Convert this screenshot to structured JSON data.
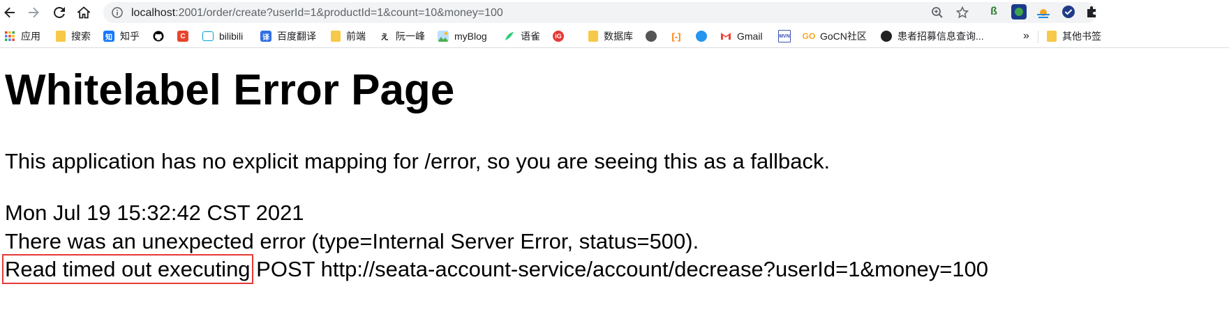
{
  "browser": {
    "url_host": "localhost",
    "url_rest": ":2001/order/create?userId=1&productId=1&count=10&money=100"
  },
  "bookmarks": [
    {
      "label": "应用",
      "icon": "apps-grid-icon",
      "color": "#ea4335"
    },
    {
      "label": "搜索",
      "icon": "folder-icon",
      "color": "#f7c948"
    },
    {
      "label": "知乎",
      "icon": "zhihu-icon",
      "color": "#1677ff"
    },
    {
      "label": "",
      "icon": "github-icon",
      "color": "#000000"
    },
    {
      "label": "",
      "icon": "c-icon",
      "color": "#e8452c"
    },
    {
      "label": "bilibili",
      "icon": "bilibili-icon",
      "color": "#00a1d6"
    },
    {
      "label": "百度翻译",
      "icon": "baidu-translate-icon",
      "color": "#2f6fe4"
    },
    {
      "label": "前端",
      "icon": "folder-icon",
      "color": "#f7c948"
    },
    {
      "label": "阮一峰",
      "icon": "ruanyifeng-icon",
      "color": "#333333"
    },
    {
      "label": "myBlog",
      "icon": "landscape-icon",
      "color": "#4caf50"
    },
    {
      "label": "语雀",
      "icon": "yuque-icon",
      "color": "#31cc79"
    },
    {
      "label": "",
      "icon": "ig-icon",
      "color": "#e53935"
    },
    {
      "label": "数据库",
      "icon": "folder-icon",
      "color": "#f7c948"
    },
    {
      "label": "",
      "icon": "globe-icon",
      "color": "#555555"
    },
    {
      "label": "",
      "icon": "bracket-icon",
      "color": "#ff7a00"
    },
    {
      "label": "",
      "icon": "docker-icon",
      "color": "#2496ed"
    },
    {
      "label": "Gmail",
      "icon": "gmail-icon",
      "color": "#ea4335"
    },
    {
      "label": "",
      "icon": "mvn-icon",
      "color": "#3f51b5"
    },
    {
      "label": "GoCN社区",
      "icon": "gocn-icon",
      "color": "#f5a623"
    },
    {
      "label": "患者招募信息查询...",
      "icon": "globe-dark-icon",
      "color": "#222222"
    }
  ],
  "bookmarks_overflow": "»",
  "other_bookmarks": "其他书签",
  "page": {
    "title": "Whitelabel Error Page",
    "message": "This application has no explicit mapping for /error, so you are seeing this as a fallback.",
    "timestamp": "Mon Jul 19 15:32:42 CST 2021",
    "error_line": "There was an unexpected error (type=Internal Server Error, status=500).",
    "detail_highlight": "Read timed out executing",
    "detail_rest": " POST http://seata-account-service/account/decrease?userId=1&money=100"
  },
  "colors": {
    "highlight_box": "#e53935",
    "omnibox_bg": "#f1f3f4"
  }
}
